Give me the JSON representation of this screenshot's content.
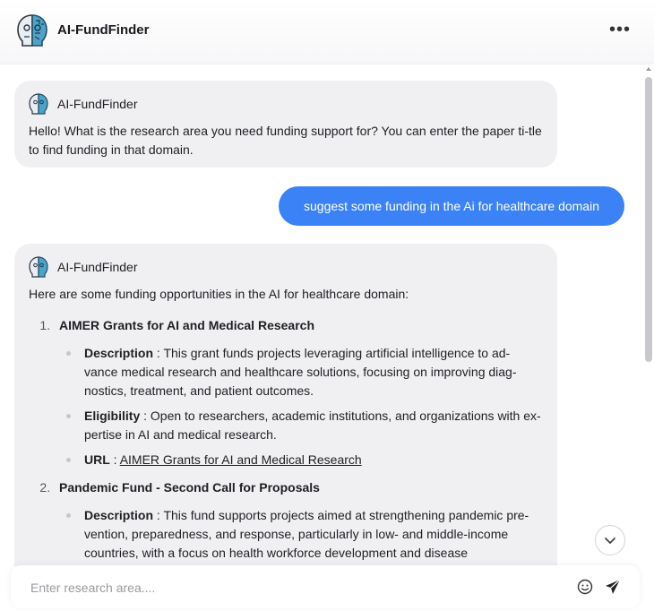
{
  "header": {
    "title": "AI-FundFinder"
  },
  "messages": {
    "bot1": {
      "name": "AI-FundFinder",
      "text": "Hello! What is the research area you need funding support for? You can enter the paper ti-tle to find funding in that domain."
    },
    "user1": {
      "text": "suggest some funding in the Ai for healthcare domain"
    },
    "bot2": {
      "name": "AI-FundFinder",
      "intro": "Here are some funding opportunities in the AI for healthcare domain:",
      "items": [
        {
          "number": "1.",
          "title": "AIMER Grants for AI and Medical Research",
          "description_label": "Description",
          "description": "This grant funds projects leveraging artificial intelligence to ad-vance medical research and healthcare solutions, focusing on improving diag-nostics, treatment, and patient outcomes.",
          "eligibility_label": "Eligibility",
          "eligibility": "Open to researchers, academic institutions, and organizations with ex-pertise in AI and medical research.",
          "url_label": "URL",
          "url_text": "AIMER Grants for AI and Medical Research"
        },
        {
          "number": "2.",
          "title": "Pandemic Fund - Second Call for Proposals",
          "description_label": "Description",
          "description": "This fund supports projects aimed at strengthening pandemic pre-vention, preparedness, and response, particularly in low- and middle-income countries, with a focus on health workforce development and disease"
        }
      ]
    }
  },
  "input": {
    "placeholder": "Enter research area...."
  },
  "colors": {
    "accent": "#3b82f6",
    "bubble_bg": "#f0f0f3"
  },
  "icons": [
    "logo-icon",
    "more-icon",
    "chevron-down-icon",
    "emoji-icon",
    "send-icon"
  ]
}
